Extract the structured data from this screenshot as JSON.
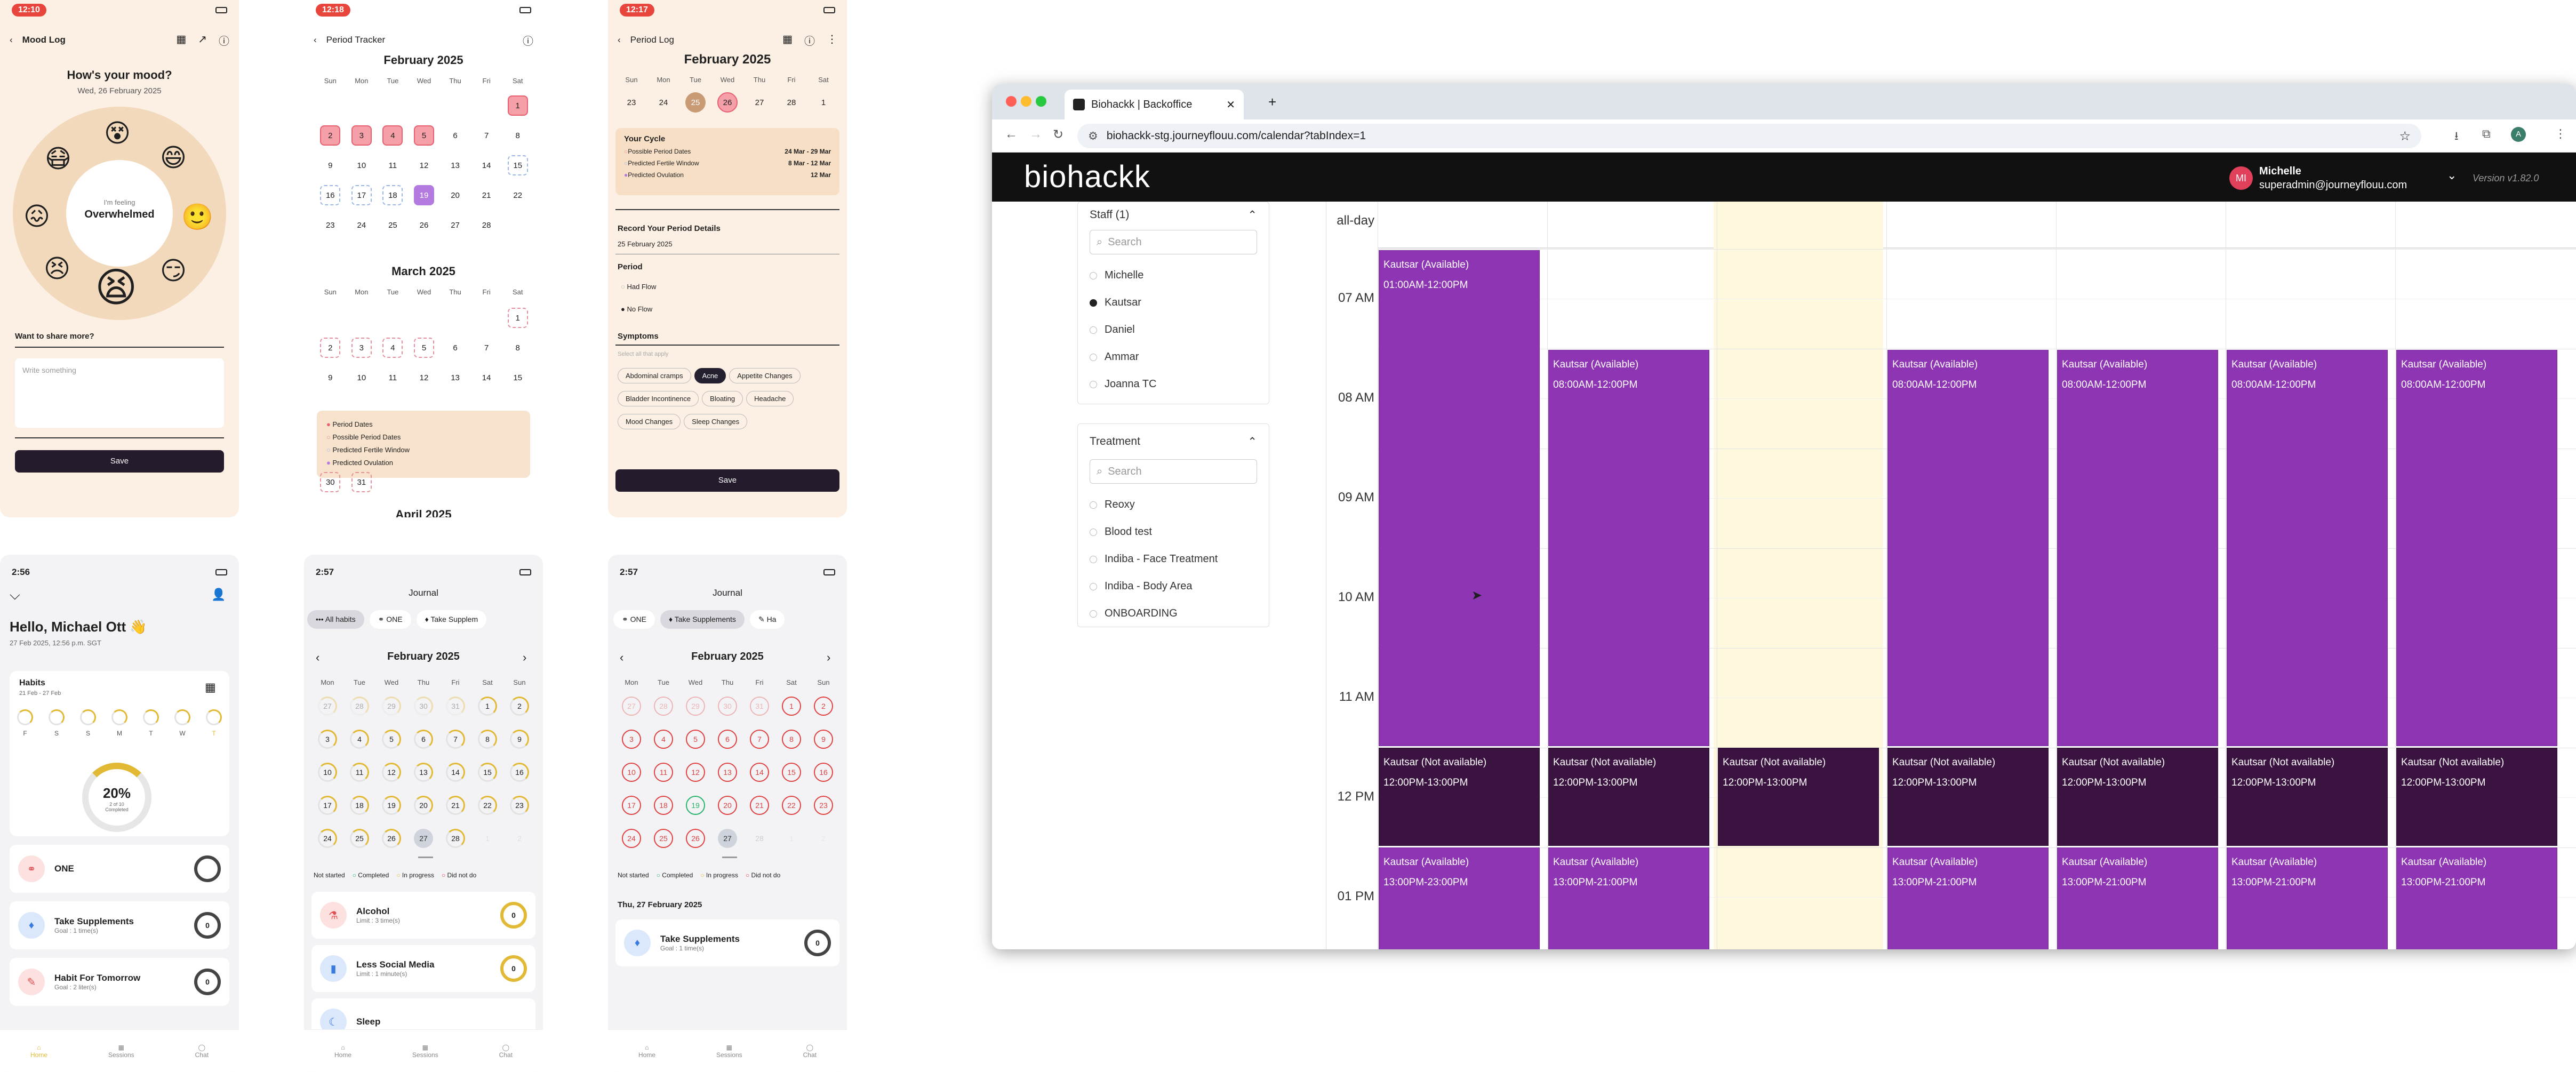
{
  "mood": {
    "time": "12:10",
    "title": "Mood Log",
    "question": "How's your mood?",
    "date": "Wed, 26 February 2025",
    "feeling_label": "I'm feeling",
    "feeling": "Overwhelmed",
    "share": "Want to share more?",
    "placeholder": "Write something",
    "save": "Save"
  },
  "tracker": {
    "time": "12:18",
    "title": "Period Tracker",
    "feb": "February 2025",
    "mar": "March 2025",
    "apr": "April 2025",
    "days": [
      "Sun",
      "Mon",
      "Tue",
      "Wed",
      "Thu",
      "Fri",
      "Sat"
    ],
    "feb_rows": [
      [
        "",
        "",
        "",
        "",
        "",
        "",
        "1"
      ],
      [
        "2",
        "3",
        "4",
        "5",
        "6",
        "7",
        "8"
      ],
      [
        "9",
        "10",
        "11",
        "12",
        "13",
        "14",
        "15"
      ],
      [
        "16",
        "17",
        "18",
        "19",
        "20",
        "21",
        "22"
      ],
      [
        "23",
        "24",
        "25",
        "26",
        "27",
        "28",
        ""
      ]
    ],
    "mar_rows": [
      [
        "",
        "",
        "",
        "",
        "",
        "",
        "1"
      ],
      [
        "2",
        "3",
        "4",
        "5",
        "6",
        "7",
        "8"
      ],
      [
        "9",
        "10",
        "11",
        "12",
        "13",
        "14",
        "15"
      ]
    ],
    "tail": [
      "30",
      "31"
    ],
    "legend": [
      "Period Dates",
      "Possible Period Dates",
      "Predicted Fertile Window",
      "Predicted Ovulation"
    ]
  },
  "log": {
    "time": "12:17",
    "title": "Period Log",
    "month": "February 2025",
    "days": [
      "Sun",
      "Mon",
      "Tue",
      "Wed",
      "Thu",
      "Fri",
      "Sat"
    ],
    "week": [
      "23",
      "24",
      "25",
      "26",
      "27",
      "28",
      "1"
    ],
    "cycle_title": "Your Cycle",
    "cycle": [
      {
        "k": "Possible Period Dates",
        "v": "24 Mar - 29 Mar"
      },
      {
        "k": "Predicted Fertile Window",
        "v": "8 Mar - 12 Mar"
      },
      {
        "k": "Predicted Ovulation",
        "v": "12 Mar"
      }
    ],
    "record": "Record Your Period Details",
    "rec_date": "25 February 2025",
    "period": "Period",
    "flow1": "Had Flow",
    "flow2": "No Flow",
    "symptoms": "Symptoms",
    "sym_hint": "Select all that apply",
    "tags": [
      "Abdominal cramps",
      "Acne",
      "Appetite Changes",
      "Bladder Incontinence",
      "Bloating",
      "Headache",
      "Mood Changes",
      "Sleep Changes"
    ],
    "save": "Save"
  },
  "home": {
    "time": "2:56",
    "greeting": "Hello, Michael Ott 👋",
    "date": "27 Feb 2025, 12:56 p.m. SGT",
    "habits": "Habits",
    "range": "21 Feb - 27 Feb",
    "wk": [
      "F",
      "S",
      "S",
      "M",
      "T",
      "W",
      "T"
    ],
    "pct": "20%",
    "pct_sub": "2 of 10",
    "pct_sub2": "Completed",
    "items": [
      {
        "name": "ONE",
        "goal": "",
        "v": ""
      },
      {
        "name": "Take Supplements",
        "goal": "Goal : 1 time(s)",
        "v": "0"
      },
      {
        "name": "Habit For Tomorrow",
        "goal": "Goal : 2 liter(s)",
        "v": "0"
      }
    ],
    "nav": [
      "Home",
      "Sessions",
      "Chat"
    ]
  },
  "journal1": {
    "time": "2:57",
    "title": "Journal",
    "chips": [
      "All habits",
      "ONE",
      "Take Supplem"
    ],
    "month": "February 2025",
    "days": [
      "Mon",
      "Tue",
      "Wed",
      "Thu",
      "Fri",
      "Sat",
      "Sun"
    ],
    "rows": [
      [
        "27",
        "28",
        "29",
        "30",
        "31",
        "1",
        "2"
      ],
      [
        "3",
        "4",
        "5",
        "6",
        "7",
        "8",
        "9"
      ],
      [
        "10",
        "11",
        "12",
        "13",
        "14",
        "15",
        "16"
      ],
      [
        "17",
        "18",
        "19",
        "20",
        "21",
        "22",
        "23"
      ],
      [
        "24",
        "25",
        "26",
        "27",
        "28",
        "1",
        "2"
      ]
    ],
    "legend": [
      "Not started",
      "Completed",
      "In progress",
      "Did not do"
    ],
    "items": [
      {
        "name": "Alcohol",
        "goal": "Limit : 3 time(s)",
        "v": "0"
      },
      {
        "name": "Less Social Media",
        "goal": "Limit : 1 minute(s)",
        "v": "0"
      },
      {
        "name": "Sleep",
        "goal": "",
        "v": ""
      }
    ],
    "nav": [
      "Home",
      "Sessions",
      "Chat"
    ]
  },
  "journal2": {
    "time": "2:57",
    "title": "Journal",
    "chips": [
      "ONE",
      "Take Supplements",
      "Ha"
    ],
    "month": "February 2025",
    "days": [
      "Mon",
      "Tue",
      "Wed",
      "Thu",
      "Fri",
      "Sat",
      "Sun"
    ],
    "rows": [
      [
        "27",
        "28",
        "29",
        "30",
        "31",
        "1",
        "2"
      ],
      [
        "3",
        "4",
        "5",
        "6",
        "7",
        "8",
        "9"
      ],
      [
        "10",
        "11",
        "12",
        "13",
        "14",
        "15",
        "16"
      ],
      [
        "17",
        "18",
        "19",
        "20",
        "21",
        "22",
        "23"
      ],
      [
        "24",
        "25",
        "26",
        "27",
        "28",
        "1",
        "2"
      ]
    ],
    "legend": [
      "Not started",
      "Completed",
      "In progress",
      "Did not do"
    ],
    "date": "Thu, 27 February 2025",
    "item": {
      "name": "Take Supplements",
      "goal": "Goal : 1 time(s)",
      "v": "0"
    },
    "nav": [
      "Home",
      "Sessions",
      "Chat"
    ]
  },
  "browser": {
    "tab": "Biohackk | Backoffice",
    "url": "biohackk-stg.journeyflouu.com/calendar?tabIndex=1",
    "brand": "biohackk",
    "user": "Michelle",
    "email": "superadmin@journeyflouu.com",
    "avatar": "MI",
    "version": "Version v1.82.0",
    "staff_title": "Staff (1)",
    "search": "Search",
    "staff": [
      "Michelle",
      "Kautsar",
      "Daniel",
      "Ammar",
      "Joanna TC"
    ],
    "treat_title": "Treatment",
    "treatments": [
      "Reoxy",
      "Blood test",
      "Indiba - Face Treatment",
      "Indiba - Body Area",
      "ONBOARDING"
    ],
    "allday": "all-day",
    "times": [
      "07 AM",
      "08 AM",
      "09 AM",
      "10 AM",
      "11 AM",
      "12 PM",
      "01 PM"
    ],
    "evt_av": "Kautsar (Available)",
    "evt_na": "Kautsar (Not available)",
    "t1": "01:00AM-12:00PM",
    "t2": "08:00AM-12:00PM",
    "t3": "12:00PM-13:00PM",
    "t4": "13:00PM-23:00PM",
    "t5": "13:00PM-21:00PM"
  }
}
